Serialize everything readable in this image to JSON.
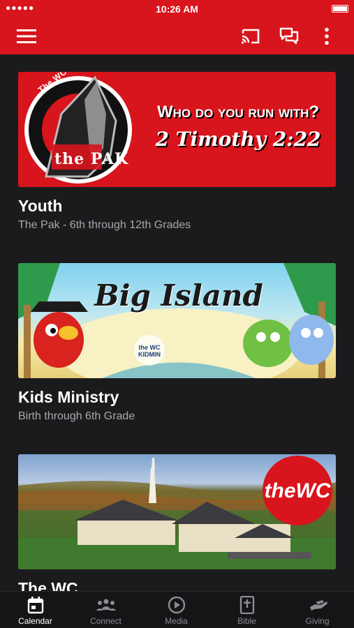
{
  "status_bar": {
    "signal": "●●●●● ",
    "time": "10:26 AM"
  },
  "app_bar": {
    "menu_icon": "menu-icon",
    "cast_icon": "cast-icon",
    "chat_icon": "chat-icon",
    "more_icon": "more-vert-icon"
  },
  "cards": [
    {
      "title": "Youth",
      "subtitle": "The Pak - 6th through 12th Grades",
      "banner": {
        "logo_top": "The WC Youth",
        "logo_mark": "the PAK",
        "line1": "Who do you run with?",
        "line2": "2 Timothy 2:22",
        "color": "#d8141c"
      }
    },
    {
      "title": "Kids Ministry",
      "subtitle": "Birth through 6th Grade",
      "banner": {
        "headline": "Big Island",
        "badge": "the WC KIDMIN"
      }
    },
    {
      "title": "The WC",
      "subtitle": "",
      "banner": {
        "badge": "theWC"
      }
    }
  ],
  "bottom_nav": {
    "tabs": [
      {
        "label": "Calendar",
        "icon": "calendar-icon",
        "active": true
      },
      {
        "label": "Connect",
        "icon": "people-icon",
        "active": false
      },
      {
        "label": "Media",
        "icon": "play-circle-icon",
        "active": false
      },
      {
        "label": "Bible",
        "icon": "bible-icon",
        "active": false
      },
      {
        "label": "Giving",
        "icon": "giving-hand-icon",
        "active": false
      }
    ]
  },
  "colors": {
    "accent": "#d8141c",
    "background": "#1b1b1d"
  }
}
